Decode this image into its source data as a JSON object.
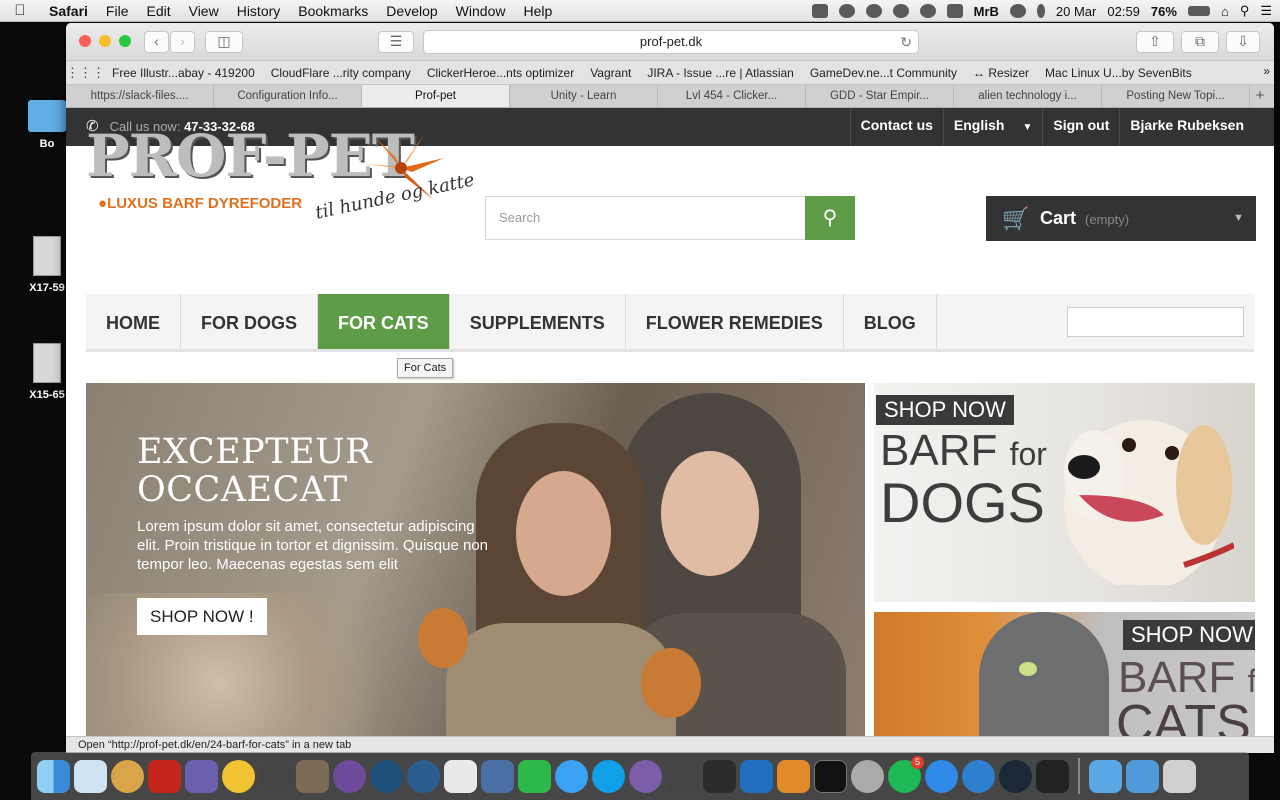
{
  "menubar": {
    "app_name": "Safari",
    "menus": [
      "File",
      "Edit",
      "View",
      "History",
      "Bookmarks",
      "Develop",
      "Window",
      "Help"
    ],
    "user": "MrB",
    "date": "20 Mar",
    "time": "02:59",
    "battery": "76%"
  },
  "desktop": {
    "items": [
      {
        "label": "Bo",
        "type": "folder"
      },
      {
        "label": "X17-59",
        "type": "file"
      },
      {
        "label": "X15-65",
        "type": "file"
      }
    ]
  },
  "browser": {
    "url": "prof-pet.dk",
    "favorites": [
      "Free Illustr...abay - 419200",
      "CloudFlare ...rity company",
      "ClickerHeroe...nts optimizer",
      "Vagrant",
      "JIRA - Issue ...re | Atlassian",
      "GameDev.ne...t Community",
      "↔ Resizer",
      "Mac Linux U...by SevenBits"
    ],
    "tabs": [
      "https://slack-files....",
      "Configuration Info...",
      "Prof-pet",
      "Unity - Learn",
      "Lvl 454 - Clicker...",
      "GDD - Star Empir...",
      "alien technology i...",
      "Posting New Topi..."
    ],
    "active_tab_index": 2,
    "status_text": "Open “http://prof-pet.dk/en/24-barf-for-cats” in a new tab"
  },
  "site": {
    "topbar": {
      "call_label": "Call us now:",
      "phone": "47-33-32-68",
      "links": [
        "Contact us",
        "English",
        "Sign out",
        "Bjarke Rubeksen"
      ]
    },
    "logo": {
      "text": "PROF-PET",
      "tagline": "LUXUS BARF DYREFODER",
      "tagline2": "til hunde og katte"
    },
    "search_placeholder": "Search",
    "cart": {
      "label": "Cart",
      "status": "(empty)"
    },
    "nav": [
      "HOME",
      "FOR DOGS",
      "FOR CATS",
      "SUPPLEMENTS",
      "FLOWER REMEDIES",
      "BLOG"
    ],
    "nav_active_index": 2,
    "tooltip": "For Cats",
    "hero": {
      "title": "EXCEPTEUR OCCAECAT",
      "text": "Lorem ipsum dolor sit amet, consectetur adipiscing elit. Proin tristique in tortor et dignissim. Quisque non tempor leo. Maecenas egestas sem elit",
      "button": "SHOP NOW !"
    },
    "banners": [
      {
        "shop_now": "SHOP NOW",
        "line1": "BARF",
        "line1b": "for",
        "line2": "DOGS"
      },
      {
        "shop_now": "SHOP NOW",
        "line1": "BARF",
        "line1b": "for",
        "line2": "CATS"
      }
    ]
  },
  "colors": {
    "accent_green": "#5f9c48",
    "topbar_dark": "#333333",
    "cart_dark": "#333333"
  }
}
